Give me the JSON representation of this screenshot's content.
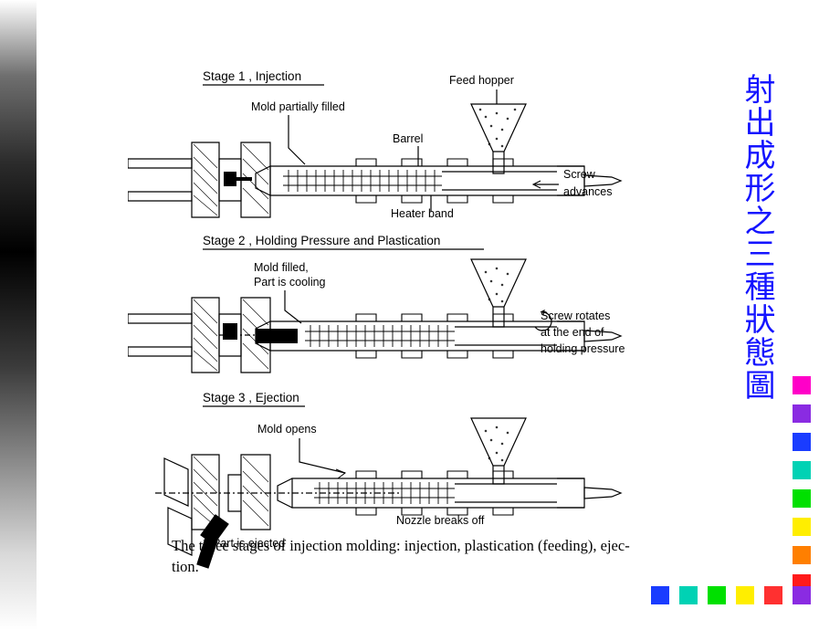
{
  "slide": {
    "vertical_title": "射出成形之三種狀態圖",
    "title_color": "#1414ff",
    "caption_line1": "The three stages of injection molding: injection, plastication (feeding), ejec-",
    "caption_line2": "tion."
  },
  "figure": {
    "stages": [
      {
        "heading": "Stage 1 , Injection",
        "labels": [
          "Mold  partially  filled",
          "Feed hopper",
          "Barrel",
          "Screw",
          "advances",
          "Heater  band"
        ]
      },
      {
        "heading": "Stage 2 , Holding Pressure and  Plastication",
        "labels": [
          "Mold  filled,",
          "Part  is  cooling",
          "Screw  rotates",
          "at the end of",
          "holding  pressure"
        ]
      },
      {
        "heading": "Stage 3 , Ejection",
        "labels": [
          "Mold  opens",
          "Part  is  ejected",
          "Nozzle  breaks off"
        ]
      }
    ]
  },
  "decorations": {
    "column_chips": [
      "#ff00c8",
      "#8a2be2",
      "#1a3cff",
      "#00d2b4",
      "#00e000",
      "#ffee00",
      "#ff7f00",
      "#ff1a1a"
    ],
    "row_chips": [
      "#1a3cff",
      "#00d2b4",
      "#00e000",
      "#ffee00",
      "#ff3030",
      "#8a2be2"
    ]
  }
}
